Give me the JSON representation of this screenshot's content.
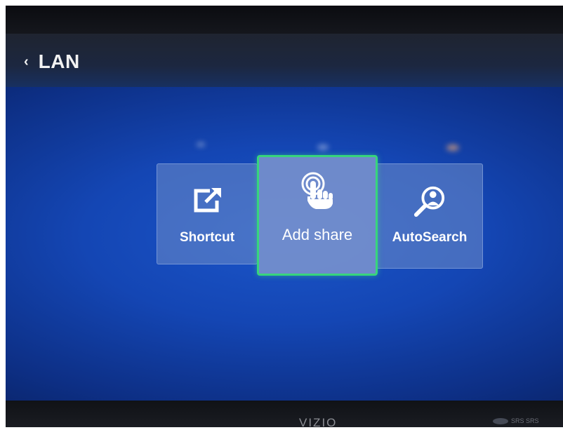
{
  "header": {
    "back_chevron": "‹",
    "title": "LAN"
  },
  "tiles": [
    {
      "label": "Shortcut",
      "icon": "shortcut-icon",
      "selected": false
    },
    {
      "label": "Add share",
      "icon": "touch-icon",
      "selected": true
    },
    {
      "label": "AutoSearch",
      "icon": "search-person-icon",
      "selected": false
    }
  ],
  "bezel": {
    "brand": "VIZIO",
    "badges": "SRS SRS"
  },
  "colors": {
    "screen_blue": "#1446b4",
    "tile_bg": "#6e8cc8",
    "focus_border": "#38d57c",
    "text": "#ffffff"
  }
}
